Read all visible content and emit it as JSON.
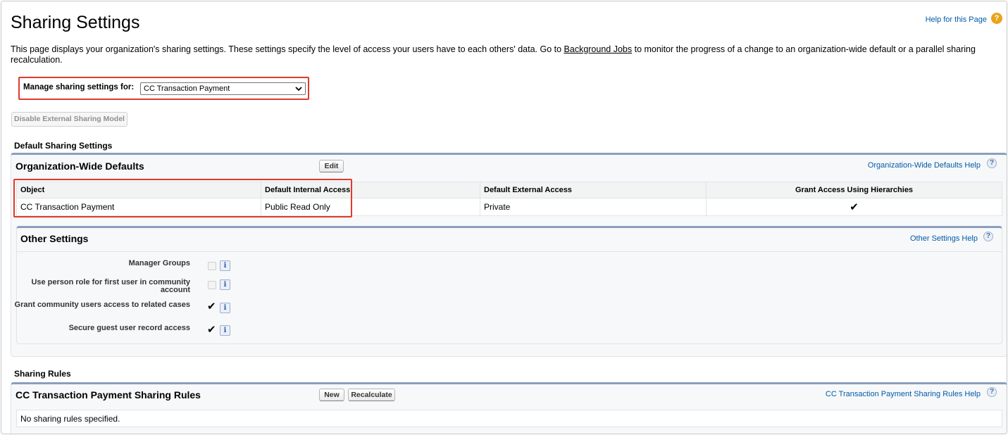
{
  "page": {
    "title": "Sharing Settings",
    "help_link": "Help for this Page",
    "help_icon": "?",
    "description_before": "This page displays your organization's sharing settings. These settings specify the level of access your users have to each others' data. Go to ",
    "description_link": "Background Jobs",
    "description_after": " to monitor the progress of a change to an organization-wide default or a parallel sharing recalculation."
  },
  "manage": {
    "label": "Manage sharing settings for:",
    "selected": "CC Transaction Payment"
  },
  "disable_button": "Disable External Sharing Model",
  "default_section_label": "Default Sharing Settings",
  "owd": {
    "title": "Organization-Wide Defaults",
    "edit_button": "Edit",
    "help_link": "Organization-Wide Defaults Help",
    "columns": [
      "Object",
      "Default Internal Access",
      "Default External Access",
      "Grant Access Using Hierarchies"
    ],
    "row": {
      "object": "CC Transaction Payment",
      "internal": "Public Read Only",
      "external": "Private",
      "hierarchies": "✔"
    }
  },
  "other": {
    "title": "Other Settings",
    "help_link": "Other Settings Help",
    "settings": [
      {
        "label": "Manager Groups",
        "checked": false
      },
      {
        "label": "Use person role for first user in community account",
        "checked": false
      },
      {
        "label": "Grant community users access to related cases",
        "checked": true
      },
      {
        "label": "Secure guest user record access",
        "checked": true
      }
    ],
    "check_glyph": "✔",
    "info_glyph": "i"
  },
  "rules_section_label": "Sharing Rules",
  "rules": {
    "title": "CC Transaction Payment Sharing Rules",
    "new_button": "New",
    "recalc_button": "Recalculate",
    "help_link": "CC Transaction Payment Sharing Rules Help",
    "empty_text": "No sharing rules specified."
  },
  "colors": {
    "link": "#015ba7",
    "highlight": "#e03a2b",
    "panel_accent": "#8a9ebe"
  }
}
